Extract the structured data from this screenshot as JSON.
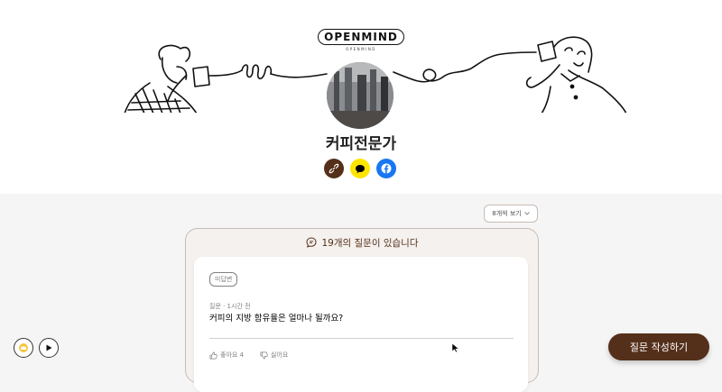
{
  "logo": {
    "main": "OPENMIND",
    "sub": "OPENMIND"
  },
  "profile": {
    "name": "커피전문가"
  },
  "share": {
    "link": "link-icon",
    "kakao": "kakao-icon",
    "facebook": "facebook-icon"
  },
  "view_toggle": {
    "label": "8개씩 보기"
  },
  "feed": {
    "header": "19개의 질문이 있습니다"
  },
  "question": {
    "badge": "미답변",
    "meta": "질문 · 1시간 전",
    "text": "커피의 지방 함유율은 얼마나 될까요?",
    "like_label": "좋아요 4",
    "dislike_label": "싫어요"
  },
  "ask_button": {
    "label": "질문 작성하기"
  },
  "colors": {
    "brown": "#542f1a",
    "kakao": "#fee500",
    "facebook": "#1877f2",
    "page_bg": "#f5f5f5"
  }
}
